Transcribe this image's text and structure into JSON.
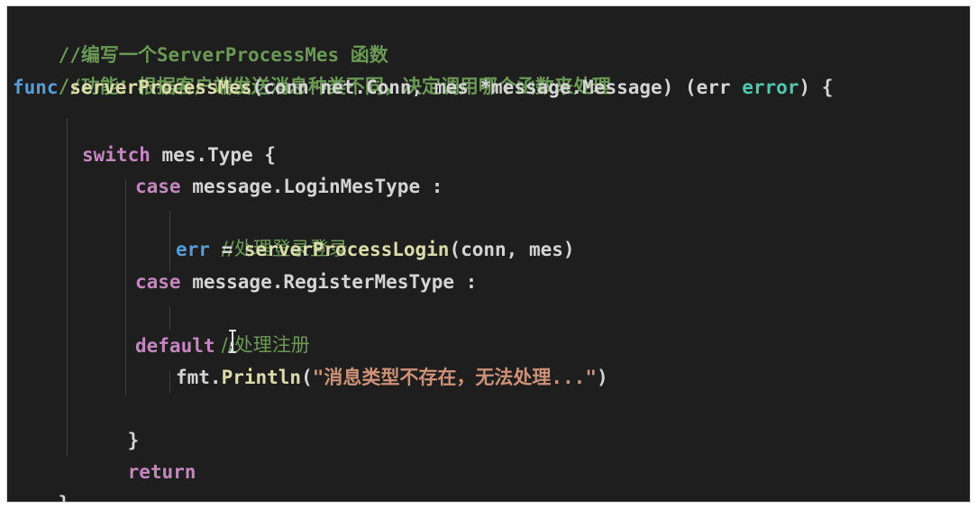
{
  "code": {
    "comment1": "//编写一个ServerProcessMes 函数",
    "comment2": "//功能：根据客户端发送消息种类不同，决定调用哪个函数来处理",
    "func_kw": "func",
    "func_name": "serverProcessMes",
    "params_open": "(conn net.Conn, mes *message.Message) (err ",
    "error_type": "error",
    "params_close": ") {",
    "switch_kw": "switch",
    "switch_expr": " mes.Type {",
    "case_kw": "case",
    "case1_expr": " message.LoginMesType :",
    "comment_login": "//处理登录登录",
    "err_var": "err",
    "assign": " = ",
    "call_login": "serverProcessLogin",
    "call_login_args": "(conn, mes)",
    "case2_expr": " message.RegisterMesType :",
    "comment_register": "//处理注册",
    "default_kw": "default",
    "default_colon": " :",
    "fmt_pkg": "fmt.",
    "println_fn": "Println",
    "paren_open": "(",
    "println_str": "\"消息类型不存在，无法处理...\"",
    "paren_close": ")",
    "close_switch": "}",
    "return_kw": "return",
    "close_func": "}"
  },
  "colors": {
    "background": "#1e1e1e",
    "keyword_control": "#c586c0",
    "keyword_storage": "#569cd6",
    "function": "#dcdcaa",
    "type": "#4ec9b0",
    "string": "#ce9178",
    "comment": "#6a9955",
    "identifier": "#d4d4d4"
  }
}
